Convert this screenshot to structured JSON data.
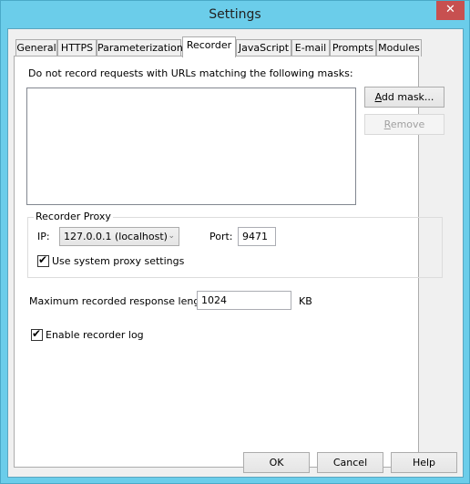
{
  "window": {
    "title": "Settings",
    "close_glyph": "✕"
  },
  "tabs": [
    {
      "label": "General",
      "active": false
    },
    {
      "label": "HTTPS",
      "active": false
    },
    {
      "label": "Parameterization",
      "active": false
    },
    {
      "label": "Recorder",
      "active": true
    },
    {
      "label": "JavaScript",
      "active": false
    },
    {
      "label": "E-mail",
      "active": false
    },
    {
      "label": "Prompts",
      "active": false
    },
    {
      "label": "Modules",
      "active": false
    }
  ],
  "recorder": {
    "masks_label": "Do not record requests with URLs matching the following masks:",
    "masks": [],
    "add_mask_button": {
      "accel": "A",
      "rest": "dd mask..."
    },
    "remove_button": {
      "accel": "R",
      "rest": "emove",
      "enabled": false
    },
    "proxy_group": {
      "caption": "Recorder Proxy",
      "ip_label": "IP:",
      "ip_value": "127.0.0.1 (localhost)",
      "port_label": "Port:",
      "port_value": "9471",
      "use_system_proxy": {
        "label": "Use system proxy settings",
        "checked": true
      }
    },
    "max_length": {
      "label": "Maximum recorded response length:",
      "value": "1024",
      "unit": "KB"
    },
    "enable_log": {
      "label": "Enable recorder log",
      "checked": true
    }
  },
  "footer": {
    "ok_label": "OK",
    "cancel_label": "Cancel",
    "help_label": "Help"
  },
  "icons": {
    "check": "✔",
    "dropdown": "⌄"
  }
}
